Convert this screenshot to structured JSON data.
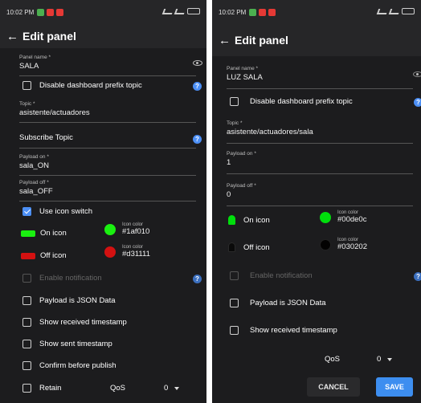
{
  "left": {
    "status_time": "10:02 PM",
    "appbar": {
      "back": "←",
      "title": "Edit panel"
    },
    "panel_name": {
      "label": "Panel name *",
      "value": "SALA"
    },
    "disable_prefix": {
      "label": "Disable dashboard prefix topic",
      "checked": false
    },
    "topic": {
      "label": "Topic *",
      "value": "asistente/actuadores"
    },
    "subscribe_topic": {
      "label": "Subscribe Topic"
    },
    "payload_on": {
      "label": "Payload on *",
      "value": "sala_ON"
    },
    "payload_off": {
      "label": "Payload off *",
      "value": "sala_OFF"
    },
    "use_icon_switch": {
      "label": "Use icon switch",
      "checked": true
    },
    "on_icon": {
      "label": "On icon",
      "color_label": "Icon color",
      "color": "#1af010"
    },
    "off_icon": {
      "label": "Off icon",
      "color_label": "Icon color",
      "color": "#d31111"
    },
    "enable_notification": {
      "label": "Enable notification",
      "disabled": true
    },
    "payload_json": {
      "label": "Payload is JSON Data"
    },
    "show_received": {
      "label": "Show received timestamp"
    },
    "show_sent": {
      "label": "Show sent timestamp"
    },
    "confirm_publish": {
      "label": "Confirm before publish"
    },
    "retain": {
      "label": "Retain"
    },
    "qos": {
      "label": "QoS",
      "value": "0"
    },
    "help_glyph": "?"
  },
  "right": {
    "status_time": "10:02 PM",
    "appbar": {
      "back": "←",
      "title": "Edit panel"
    },
    "panel_name": {
      "label": "Panel name *",
      "value": "LUZ SALA"
    },
    "disable_prefix": {
      "label": "Disable dashboard prefix topic",
      "checked": false
    },
    "topic": {
      "label": "Topic *",
      "value": "asistente/actuadores/sala"
    },
    "payload_on": {
      "label": "Payload on *",
      "value": "1"
    },
    "payload_off": {
      "label": "Payload off *",
      "value": "0"
    },
    "on_icon": {
      "label": "On icon",
      "color_label": "Icon color",
      "color": "#00de0c"
    },
    "off_icon": {
      "label": "Off icon",
      "color_label": "Icon color",
      "color": "#030202"
    },
    "enable_notification": {
      "label": "Enable notification",
      "disabled": true
    },
    "payload_json": {
      "label": "Payload is JSON Data"
    },
    "show_received": {
      "label": "Show received timestamp"
    },
    "qos": {
      "label": "QoS",
      "value": "0"
    },
    "cancel_button": "CANCEL",
    "save_button": "SAVE",
    "help_glyph": "?"
  },
  "colors": {
    "background": "#1c1c1e",
    "bar": "#262628",
    "accent": "#4c8ff5",
    "on_green": "#1af010",
    "off_red": "#d31111",
    "right_on_green": "#00de0c",
    "right_off": "#030202"
  },
  "icons": {
    "back": "arrow-left-icon",
    "visibility": "eye-icon",
    "help": "help-circle-icon",
    "dropdown": "chevron-down-icon",
    "bulb": "lightbulb-icon",
    "toggle": "toggle-switch-icon"
  }
}
